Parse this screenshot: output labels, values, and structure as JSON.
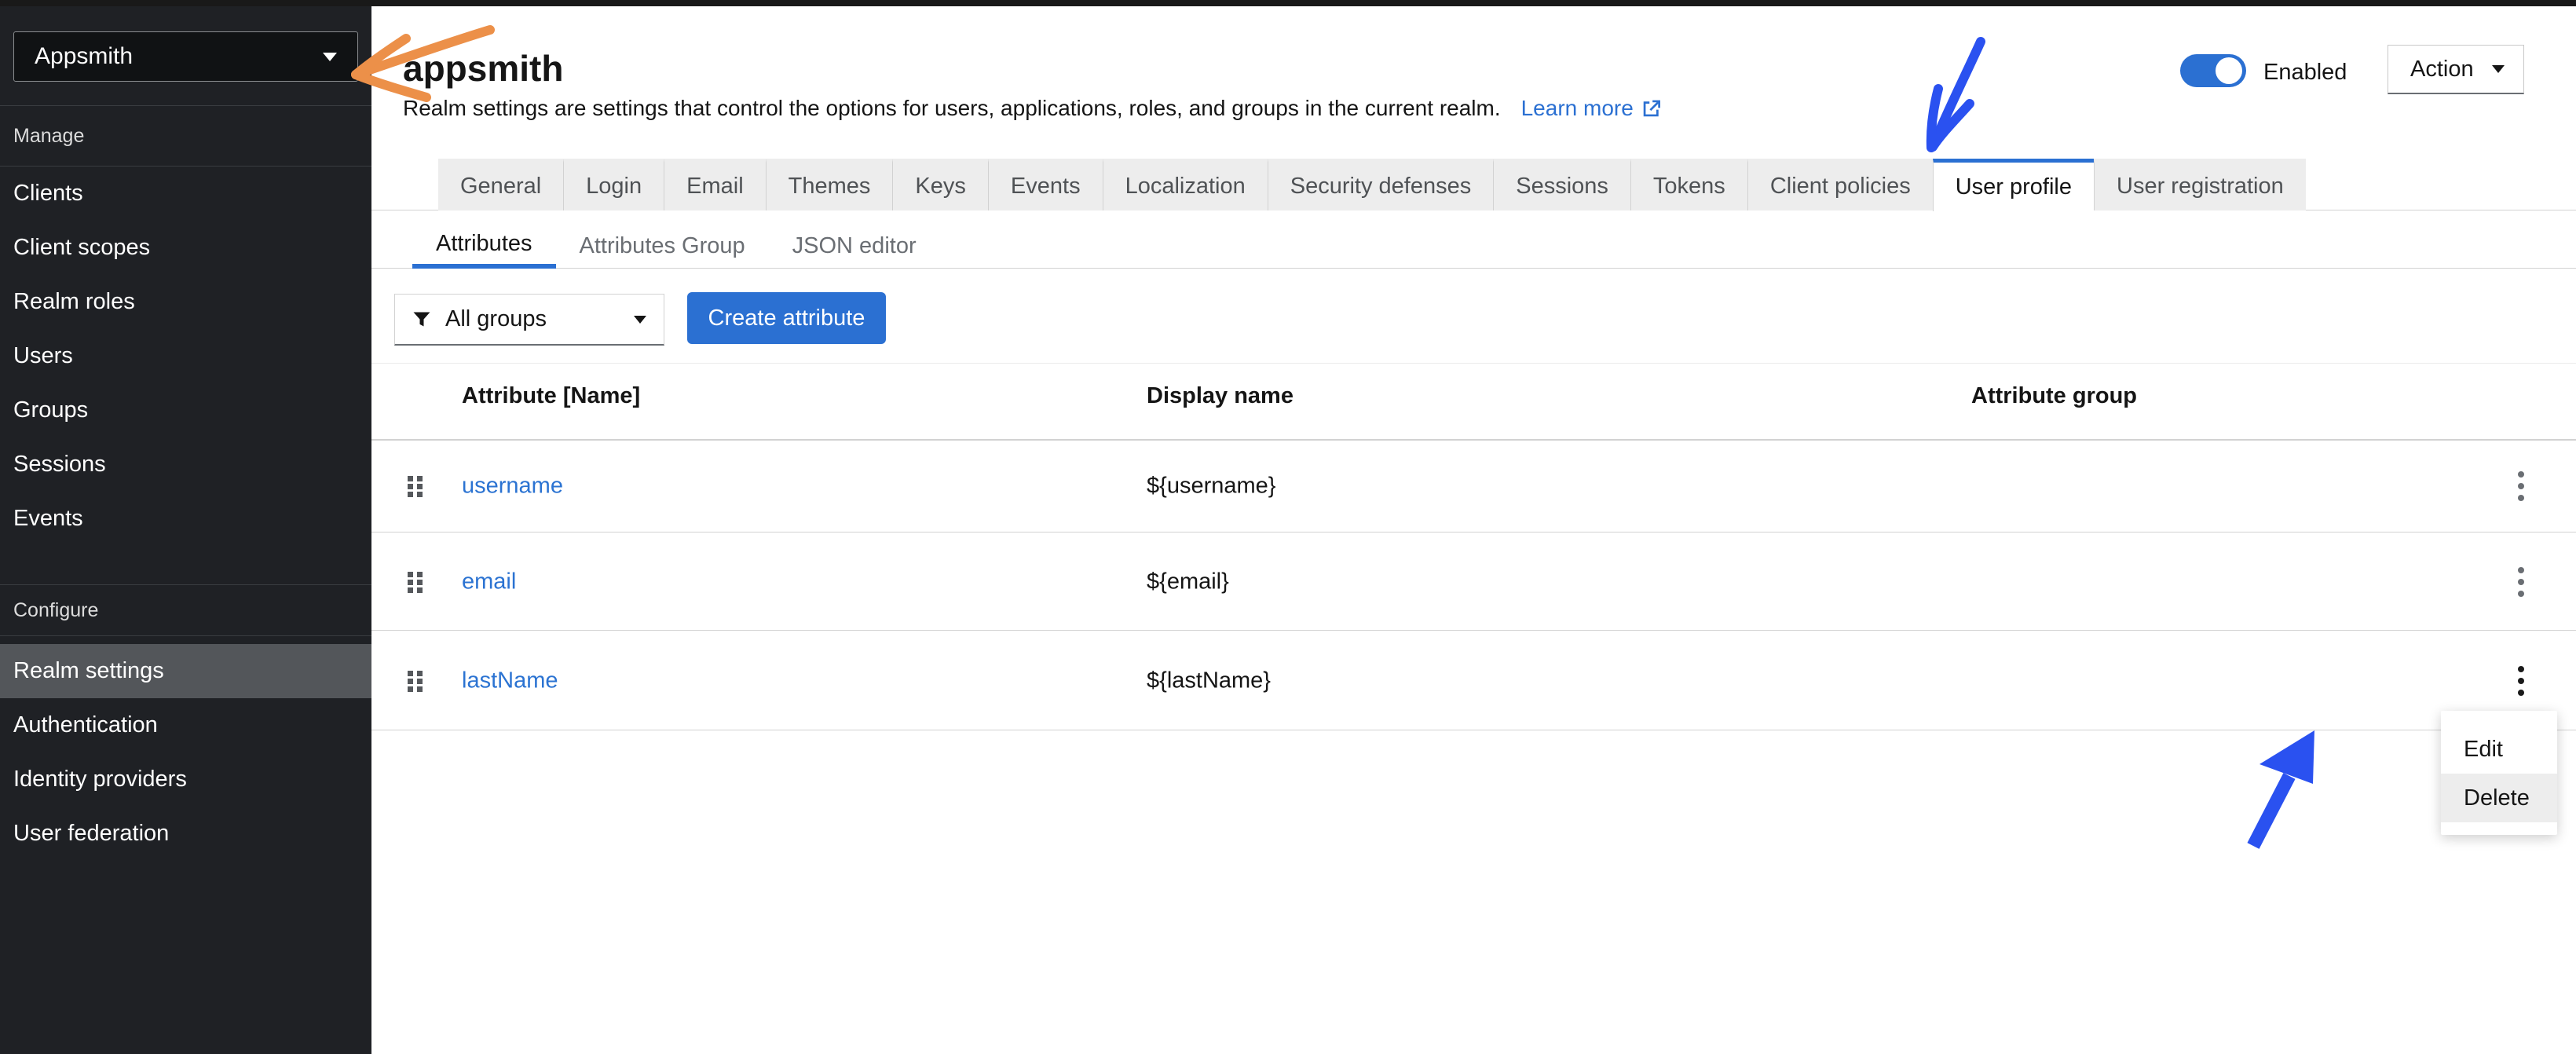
{
  "sidebar": {
    "realm_selector": {
      "value": "Appsmith"
    },
    "manage": {
      "label": "Manage",
      "items": [
        "Clients",
        "Client scopes",
        "Realm roles",
        "Users",
        "Groups",
        "Sessions",
        "Events"
      ]
    },
    "configure": {
      "label": "Configure",
      "items": [
        "Realm settings",
        "Authentication",
        "Identity providers",
        "User federation"
      ],
      "active_item": "Realm settings"
    }
  },
  "header": {
    "title": "appsmith",
    "description": "Realm settings are settings that control the options for users, applications, roles, and groups in the current realm.",
    "learn_more_label": "Learn more",
    "enabled_label": "Enabled",
    "action_label": "Action"
  },
  "tabs": {
    "active": "User profile",
    "items": [
      "General",
      "Login",
      "Email",
      "Themes",
      "Keys",
      "Events",
      "Localization",
      "Security defenses",
      "Sessions",
      "Tokens",
      "Client policies",
      "User profile",
      "User registration"
    ]
  },
  "subtabs": {
    "active": "Attributes",
    "items": [
      "Attributes",
      "Attributes Group",
      "JSON editor"
    ]
  },
  "toolbar": {
    "filter_value": "All groups",
    "create_label": "Create attribute"
  },
  "table": {
    "headers": [
      "Attribute [Name]",
      "Display name",
      "Attribute group"
    ],
    "rows": [
      {
        "name": "username",
        "display": "${username}",
        "group": ""
      },
      {
        "name": "email",
        "display": "${email}",
        "group": ""
      },
      {
        "name": "lastName",
        "display": "${lastName}",
        "group": ""
      }
    ]
  },
  "context_menu": {
    "items": [
      "Edit",
      "Delete"
    ],
    "highlighted": "Delete"
  },
  "colors": {
    "accent_blue": "#2b70d2",
    "link_blue": "#2b73d2",
    "annotation_blue": "#2a51f0",
    "annotation_orange": "#ec9049",
    "sidebar_bg": "#1f2125",
    "sidebar_active_bg": "#53565a",
    "tab_bg": "#ededed",
    "menu_highlight": "#ededed"
  }
}
